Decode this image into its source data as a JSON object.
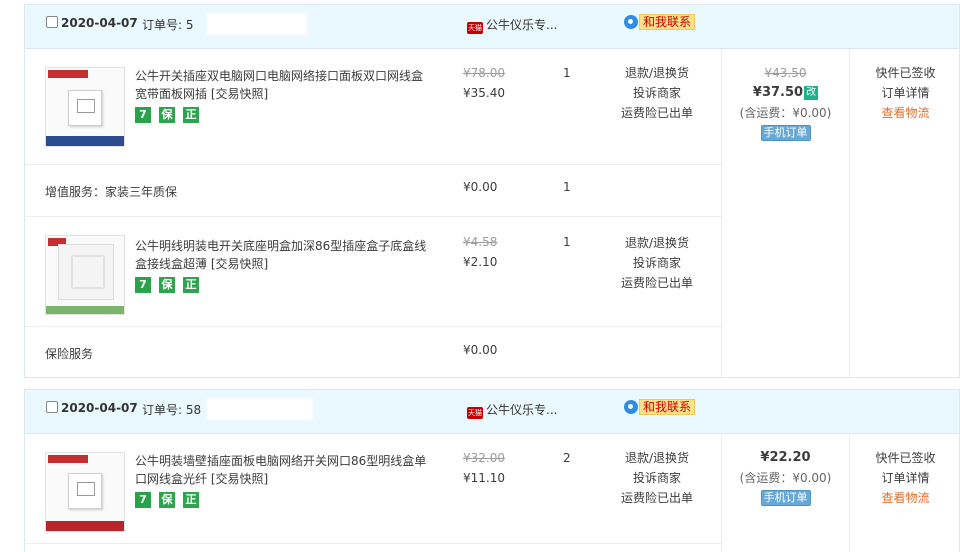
{
  "orders": [
    {
      "date": "2020-04-07",
      "order_no_label": "订单号: 5",
      "shop_badge": "天猫",
      "shop_name": "公牛仪乐专...",
      "contact_label": "和我联系",
      "items": [
        {
          "title": "公牛开关插座双电脑网口电脑网络接口面板双口网线盒宽带面板网插",
          "snapshot": "[交易快照]",
          "badges": [
            "7",
            "保",
            "正"
          ],
          "original_price": "¥78.00",
          "price": "¥35.40",
          "qty": "1",
          "ops": [
            "退款/退换货",
            "投诉商家",
            "运费险已出单"
          ]
        },
        {
          "title": "公牛明线明装电开关底座明盒加深86型插座盒子底盒线盒接线盒超薄",
          "snapshot": "[交易快照]",
          "badges": [
            "7",
            "保",
            "正"
          ],
          "original_price": "¥4.58",
          "price": "¥2.10",
          "qty": "1",
          "ops": [
            "退款/退换货",
            "投诉商家",
            "运费险已出单"
          ]
        }
      ],
      "services": [
        {
          "label": "增值服务：家装三年质保",
          "price": "¥0.00",
          "qty": "1"
        },
        {
          "label": "保险服务",
          "price": "¥0.00",
          "qty": ""
        }
      ],
      "total": {
        "original": "¥43.50",
        "amount": "¥37.50",
        "modified_badge": "改",
        "shipping": "(含运费：¥0.00)",
        "mobile_order": "手机订单"
      },
      "status": [
        "快件已签收",
        "订单详情",
        "查看物流"
      ]
    },
    {
      "date": "2020-04-07",
      "order_no_label": "订单号: 58",
      "shop_badge": "天猫",
      "shop_name": "公牛仪乐专...",
      "contact_label": "和我联系",
      "items": [
        {
          "title": "公牛明装墙壁插座面板电脑网络开关网口86型明线盒单口网线盒光纤",
          "snapshot": "[交易快照]",
          "badges": [
            "7",
            "保",
            "正"
          ],
          "original_price": "¥32.00",
          "price": "¥11.10",
          "qty": "2",
          "ops": [
            "退款/退换货",
            "投诉商家",
            "运费险已出单"
          ]
        }
      ],
      "total": {
        "amount": "¥22.20",
        "shipping": "(含运费：¥0.00)",
        "mobile_order": "手机订单"
      },
      "status": [
        "快件已签收",
        "订单详情",
        "查看物流"
      ]
    }
  ],
  "icons": {
    "checkbox": "checkbox-icon",
    "tmall": "tmall-icon",
    "wangwang": "wangwang-icon",
    "seven_day": "seven-day-return-icon",
    "guarantee": "guarantee-icon",
    "authentic": "authentic-icon"
  },
  "colors": {
    "header_bg": "#eaf8ff",
    "logistics_link": "#e46d2c",
    "badge_green": "#2ea44f",
    "mobile_badge": "#66a8d6"
  }
}
